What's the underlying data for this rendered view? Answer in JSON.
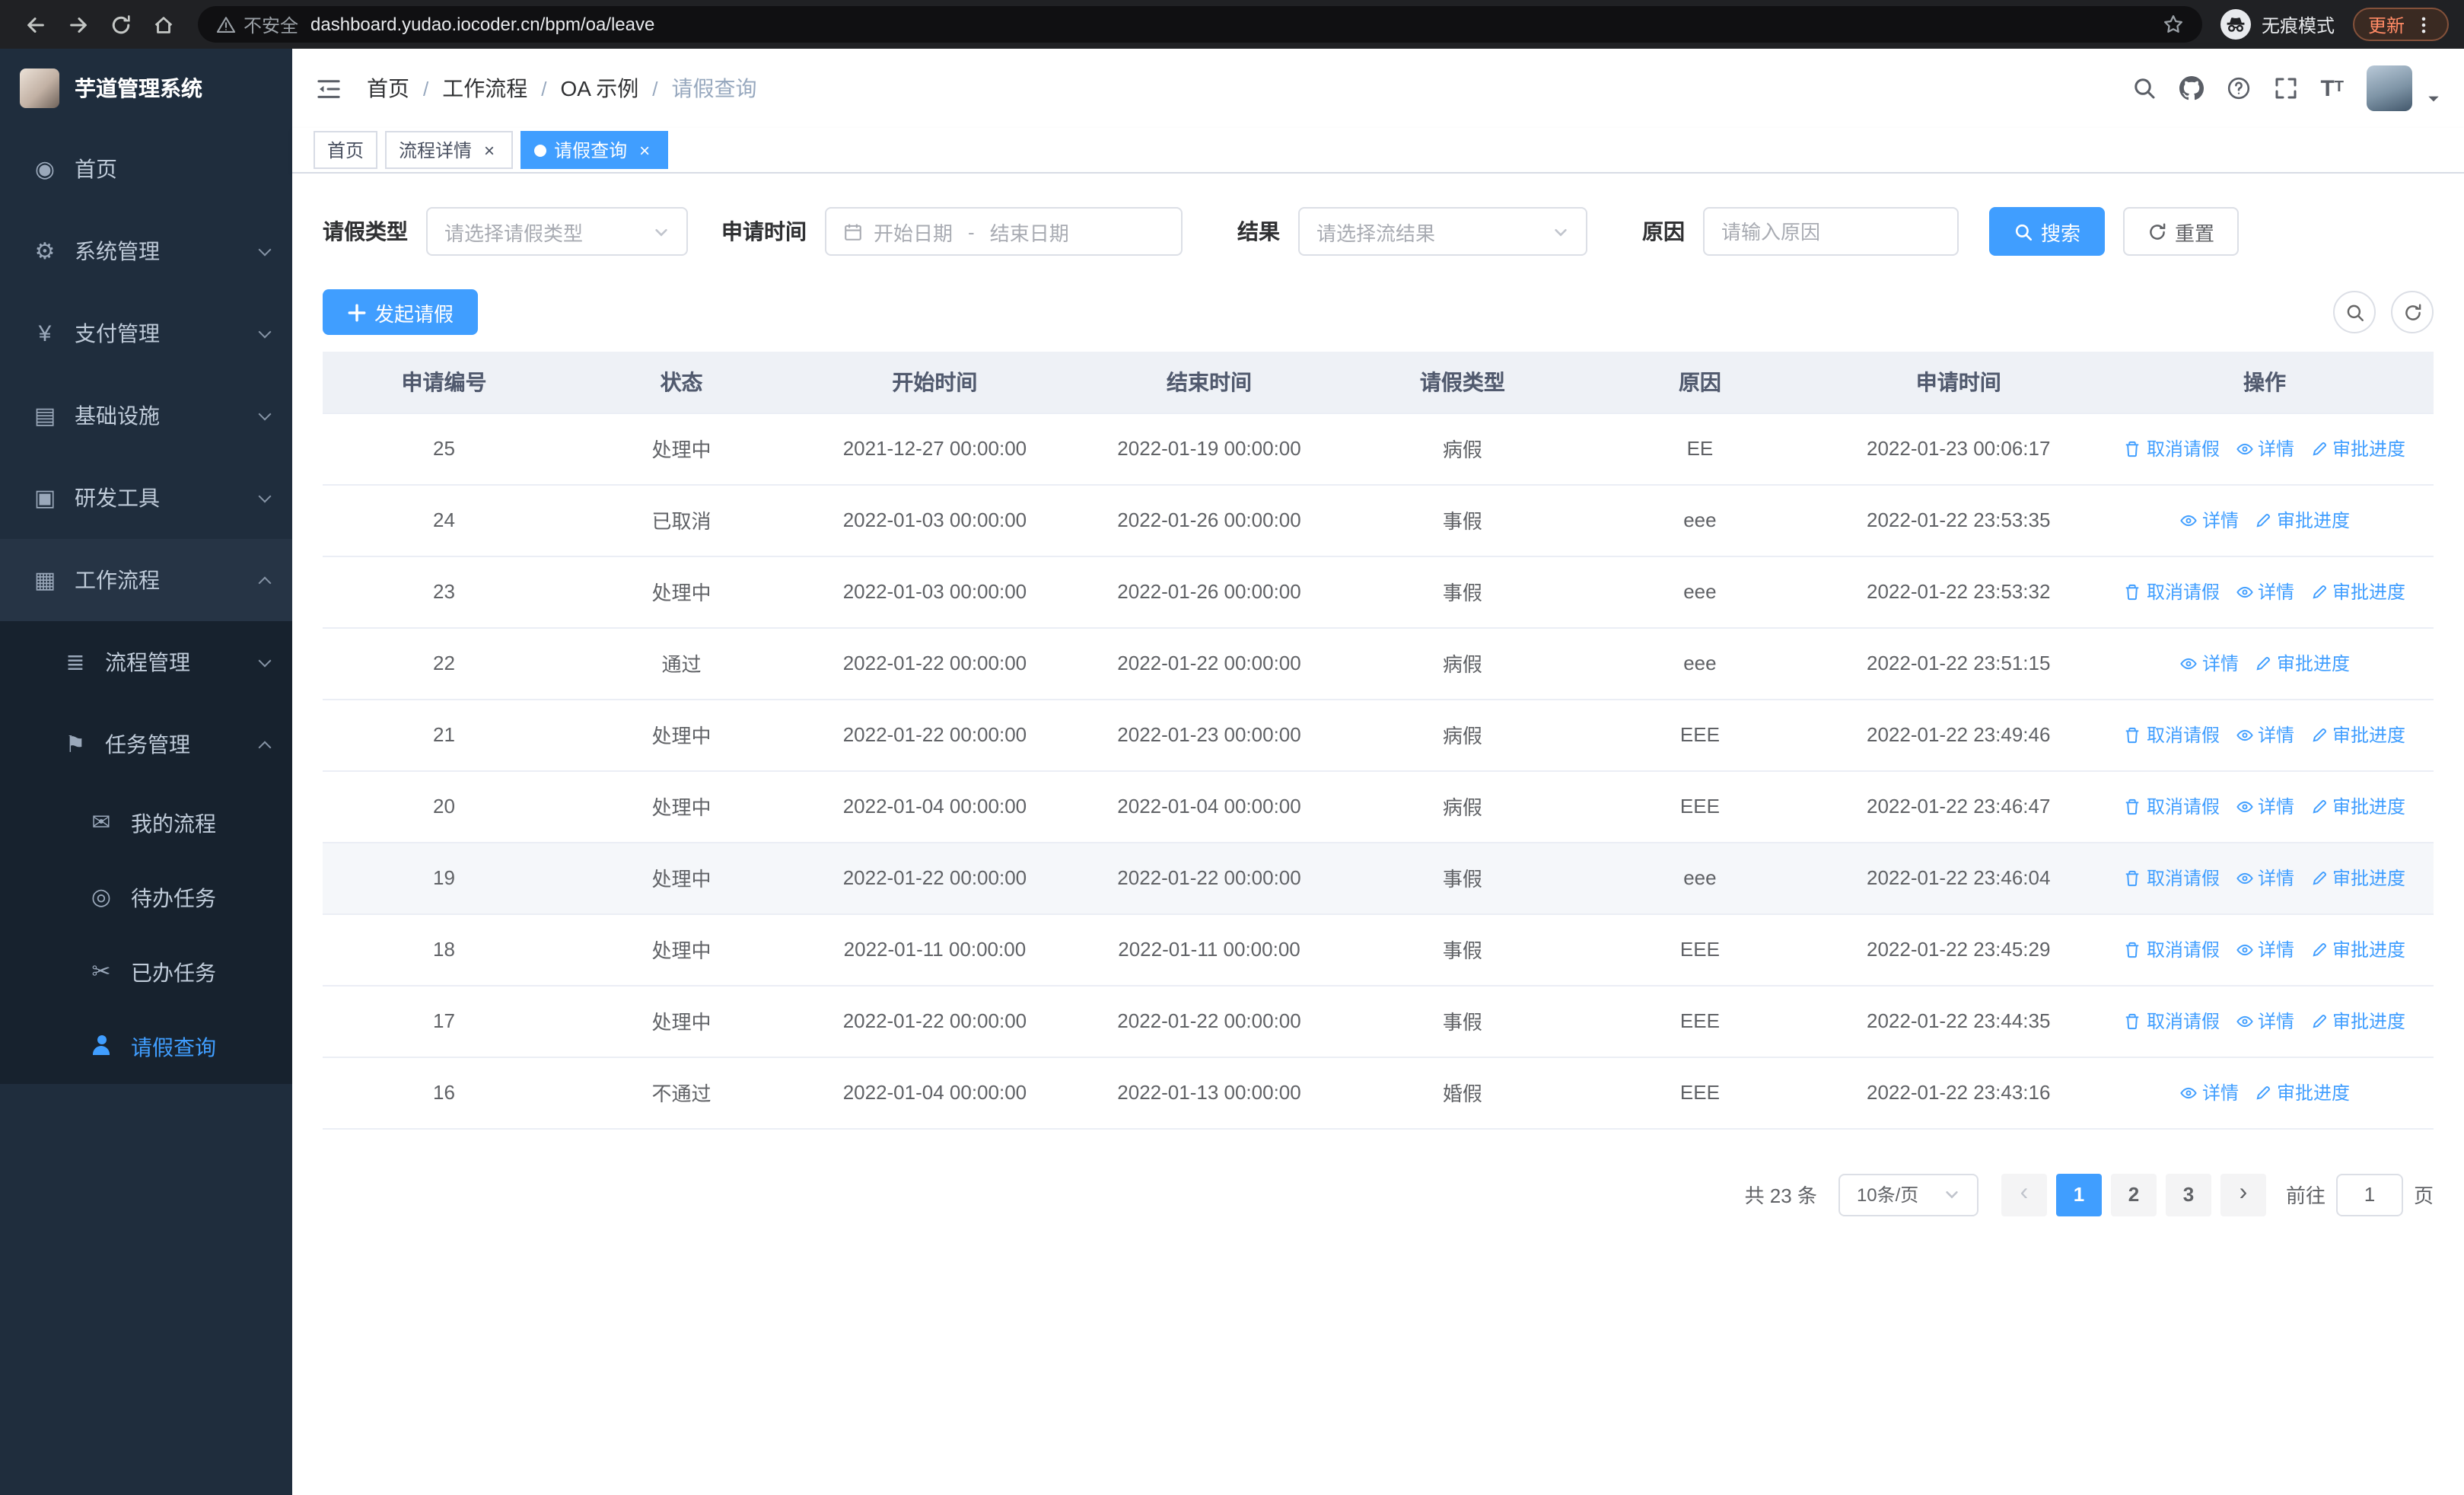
{
  "browser_chrome": {
    "security_label": "不安全",
    "url": "dashboard.yudao.iocoder.cn/bpm/oa/leave",
    "incognito_label": "无痕模式",
    "update_label": "更新"
  },
  "sidebar": {
    "logo_title": "芋道管理系统",
    "menu": [
      {
        "label": "首页",
        "icon": "dashboard-icon"
      },
      {
        "label": "系统管理",
        "icon": "gear-icon",
        "arrow": "down"
      },
      {
        "label": "支付管理",
        "icon": "payment-icon",
        "arrow": "down"
      },
      {
        "label": "基础设施",
        "icon": "infrastructure-icon",
        "arrow": "down"
      },
      {
        "label": "研发工具",
        "icon": "devtools-icon",
        "arrow": "down"
      },
      {
        "label": "工作流程",
        "icon": "workflow-icon",
        "arrow": "up",
        "expanded": true
      }
    ],
    "workflow_children": [
      {
        "label": "流程管理",
        "icon": "process-icon",
        "arrow": "down"
      },
      {
        "label": "任务管理",
        "icon": "task-icon",
        "arrow": "up",
        "expanded": true
      }
    ],
    "task_children": [
      {
        "label": "我的流程",
        "icon": "message-icon"
      },
      {
        "label": "待办任务",
        "icon": "eye-icon"
      },
      {
        "label": "已办任务",
        "icon": "scissors-icon"
      },
      {
        "label": "请假查询",
        "icon": "user-icon",
        "active": true
      }
    ]
  },
  "navbar": {
    "breadcrumb": [
      "首页",
      "工作流程",
      "OA 示例",
      "请假查询"
    ],
    "separator": "/"
  },
  "tabs": [
    {
      "label": "首页",
      "closable": false,
      "active": false
    },
    {
      "label": "流程详情",
      "closable": true,
      "active": false
    },
    {
      "label": "请假查询",
      "closable": true,
      "active": true
    }
  ],
  "filters": {
    "leave_type": {
      "label": "请假类型",
      "placeholder": "请选择请假类型"
    },
    "apply_time": {
      "label": "申请时间",
      "start_placeholder": "开始日期",
      "separator": "-",
      "end_placeholder": "结束日期"
    },
    "result": {
      "label": "结果",
      "placeholder": "请选择流结果"
    },
    "reason": {
      "label": "原因",
      "placeholder": "请输入原因"
    },
    "search_label": "搜索",
    "reset_label": "重置"
  },
  "toolbar": {
    "create_label": "发起请假"
  },
  "table": {
    "columns": [
      "申请编号",
      "状态",
      "开始时间",
      "结束时间",
      "请假类型",
      "原因",
      "申请时间",
      "操作"
    ],
    "action_labels": {
      "cancel": "取消请假",
      "detail": "详情",
      "progress": "审批进度"
    },
    "rows": [
      {
        "id": "25",
        "status": "处理中",
        "start": "2021-12-27 00:00:00",
        "end": "2022-01-19 00:00:00",
        "type": "病假",
        "reason": "EE",
        "applied": "2022-01-23 00:06:17",
        "actions": [
          "cancel",
          "detail",
          "progress"
        ]
      },
      {
        "id": "24",
        "status": "已取消",
        "start": "2022-01-03 00:00:00",
        "end": "2022-01-26 00:00:00",
        "type": "事假",
        "reason": "eee",
        "applied": "2022-01-22 23:53:35",
        "actions": [
          "detail",
          "progress"
        ]
      },
      {
        "id": "23",
        "status": "处理中",
        "start": "2022-01-03 00:00:00",
        "end": "2022-01-26 00:00:00",
        "type": "事假",
        "reason": "eee",
        "applied": "2022-01-22 23:53:32",
        "actions": [
          "cancel",
          "detail",
          "progress"
        ]
      },
      {
        "id": "22",
        "status": "通过",
        "start": "2022-01-22 00:00:00",
        "end": "2022-01-22 00:00:00",
        "type": "病假",
        "reason": "eee",
        "applied": "2022-01-22 23:51:15",
        "actions": [
          "detail",
          "progress"
        ]
      },
      {
        "id": "21",
        "status": "处理中",
        "start": "2022-01-22 00:00:00",
        "end": "2022-01-23 00:00:00",
        "type": "病假",
        "reason": "EEE",
        "applied": "2022-01-22 23:49:46",
        "actions": [
          "cancel",
          "detail",
          "progress"
        ]
      },
      {
        "id": "20",
        "status": "处理中",
        "start": "2022-01-04 00:00:00",
        "end": "2022-01-04 00:00:00",
        "type": "病假",
        "reason": "EEE",
        "applied": "2022-01-22 23:46:47",
        "actions": [
          "cancel",
          "detail",
          "progress"
        ]
      },
      {
        "id": "19",
        "status": "处理中",
        "start": "2022-01-22 00:00:00",
        "end": "2022-01-22 00:00:00",
        "type": "事假",
        "reason": "eee",
        "applied": "2022-01-22 23:46:04",
        "actions": [
          "cancel",
          "detail",
          "progress"
        ],
        "highlighted": true
      },
      {
        "id": "18",
        "status": "处理中",
        "start": "2022-01-11 00:00:00",
        "end": "2022-01-11 00:00:00",
        "type": "事假",
        "reason": "EEE",
        "applied": "2022-01-22 23:45:29",
        "actions": [
          "cancel",
          "detail",
          "progress"
        ]
      },
      {
        "id": "17",
        "status": "处理中",
        "start": "2022-01-22 00:00:00",
        "end": "2022-01-22 00:00:00",
        "type": "事假",
        "reason": "EEE",
        "applied": "2022-01-22 23:44:35",
        "actions": [
          "cancel",
          "detail",
          "progress"
        ]
      },
      {
        "id": "16",
        "status": "不通过",
        "start": "2022-01-04 00:00:00",
        "end": "2022-01-13 00:00:00",
        "type": "婚假",
        "reason": "EEE",
        "applied": "2022-01-22 23:43:16",
        "actions": [
          "detail",
          "progress"
        ]
      }
    ]
  },
  "pagination": {
    "total_text": "共 23 条",
    "page_size": "10条/页",
    "prev": "‹",
    "next": "›",
    "pages": [
      "1",
      "2",
      "3"
    ],
    "active_page": "1",
    "goto_label": "前往",
    "goto_value": "1",
    "goto_suffix": "页"
  },
  "colors": {
    "primary": "#409eff",
    "sidebar_bg": "#1f2d3d",
    "sidebar_submenu_bg": "#17222e",
    "table_header_bg": "#eef1f6",
    "link": "#409eff"
  }
}
